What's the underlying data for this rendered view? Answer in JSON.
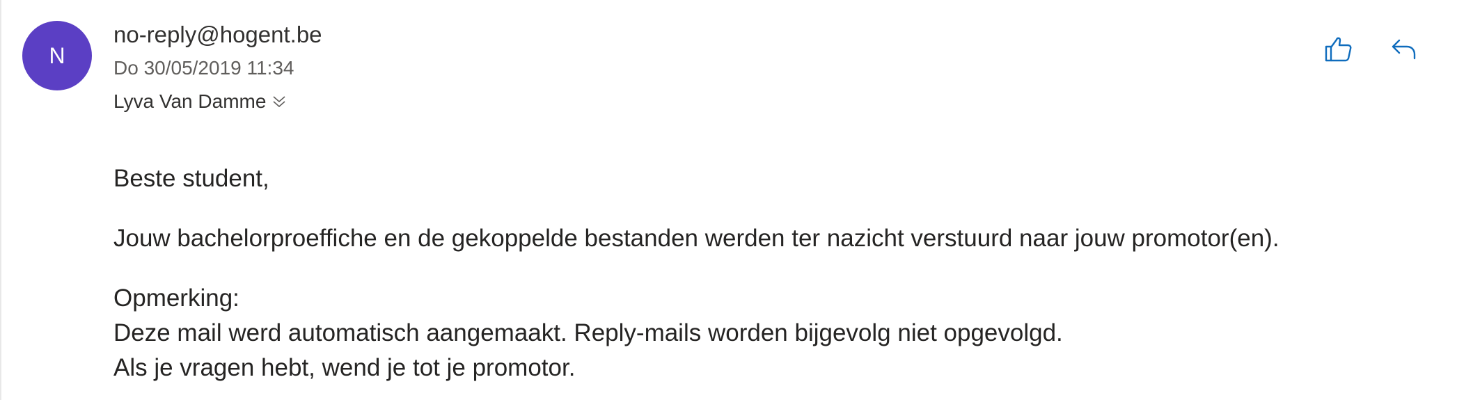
{
  "colors": {
    "avatar_bg": "#5b3fc4",
    "accent_blue": "#0f6cbd",
    "text_primary": "#252423",
    "text_secondary": "#605e5c"
  },
  "email": {
    "avatar_initial": "N",
    "sender": "no-reply@hogent.be",
    "date": "Do 30/05/2019 11:34",
    "recipient": "Lyva Van Damme",
    "actions": [
      {
        "name": "like",
        "icon": "thumbs-up-icon"
      },
      {
        "name": "reply",
        "icon": "reply-icon"
      }
    ],
    "body": {
      "greeting": "Beste student,",
      "main": "Jouw bachelorproeffiche en de gekoppelde bestanden werden ter nazicht verstuurd naar jouw promotor(en).",
      "note_heading": "Opmerking:",
      "note_line1": "Deze mail werd automatisch aangemaakt. Reply-mails worden bijgevolg niet opgevolgd.",
      "note_line2": "Als je vragen hebt, wend je tot je promotor."
    }
  }
}
